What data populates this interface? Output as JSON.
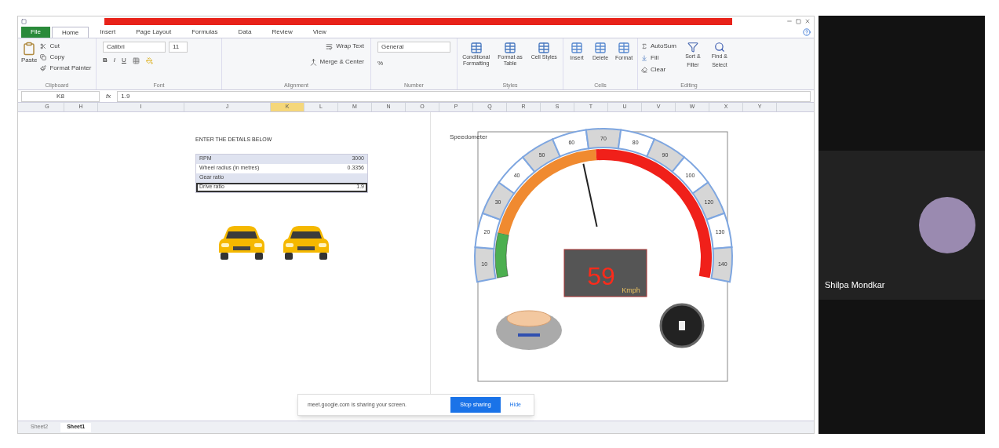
{
  "excel": {
    "ribbon_tabs": [
      {
        "label": "File",
        "kind": "file",
        "selected": false
      },
      {
        "label": "Home",
        "kind": "tab",
        "selected": true
      },
      {
        "label": "Insert",
        "kind": "tab",
        "selected": false
      },
      {
        "label": "Page Layout",
        "kind": "tab",
        "selected": false
      },
      {
        "label": "Formulas",
        "kind": "tab",
        "selected": false
      },
      {
        "label": "Data",
        "kind": "tab",
        "selected": false
      },
      {
        "label": "Review",
        "kind": "tab",
        "selected": false
      },
      {
        "label": "View",
        "kind": "tab",
        "selected": false
      }
    ],
    "clipboard": {
      "paste": "Paste",
      "cut": "Cut",
      "copy": "Copy",
      "format_painter": "Format Painter",
      "group": "Clipboard"
    },
    "font": {
      "name": "Calibri",
      "size": "11",
      "bold": "B",
      "italic": "I",
      "underline": "U",
      "group": "Font"
    },
    "alignment": {
      "wrap": "Wrap Text",
      "merge": "Merge & Center",
      "group": "Alignment"
    },
    "number": {
      "format": "General",
      "percent": "%",
      "group": "Number"
    },
    "styles": {
      "buttons": [
        "Conditional Formatting",
        "Format as Table",
        "Cell Styles"
      ],
      "group": "Styles"
    },
    "cells": {
      "buttons": [
        "Insert",
        "Delete",
        "Format"
      ],
      "group": "Cells"
    },
    "editing": {
      "autosum": "AutoSum",
      "fill": "Fill",
      "clear": "Clear",
      "sort": "Sort & Filter",
      "find": "Find & Select",
      "group": "Editing"
    },
    "formula_bar": {
      "name_box": "K8",
      "fx": "fx",
      "value": "1.9"
    },
    "columns": [
      {
        "label": "G",
        "selected": false
      },
      {
        "label": "H",
        "selected": false
      },
      {
        "label": "I",
        "selected": false
      },
      {
        "label": "J",
        "selected": false
      },
      {
        "label": "K",
        "selected": true
      },
      {
        "label": "L",
        "selected": false
      },
      {
        "label": "M",
        "selected": false
      },
      {
        "label": "N",
        "selected": false
      },
      {
        "label": "O",
        "selected": false
      },
      {
        "label": "P",
        "selected": false
      },
      {
        "label": "Q",
        "selected": false
      },
      {
        "label": "R",
        "selected": false
      },
      {
        "label": "S",
        "selected": false
      },
      {
        "label": "T",
        "selected": false
      },
      {
        "label": "U",
        "selected": false
      },
      {
        "label": "V",
        "selected": false
      },
      {
        "label": "W",
        "selected": false
      },
      {
        "label": "X",
        "selected": false
      },
      {
        "label": "Y",
        "selected": false
      }
    ],
    "details": {
      "heading": "ENTER THE DETAILS BELOW",
      "rows": [
        {
          "label": "RPM",
          "value": "3000",
          "selected": false
        },
        {
          "label": "Wheel radius (in metres)",
          "value": "0.3356",
          "selected": false
        },
        {
          "label": "Gear ratio",
          "selected": false
        },
        {
          "label": "Drive ratio",
          "value": "1.9",
          "selected": true
        }
      ]
    },
    "speedometer": {
      "title": "Speedometer",
      "ticks": [
        "10",
        "20",
        "30",
        "40",
        "50",
        "60",
        "70",
        "80",
        "90",
        "100",
        "120",
        "130",
        "140"
      ],
      "needle": {
        "level": 0.44
      },
      "reading": "59",
      "unit": "Kmph"
    },
    "sheet_tabs": [
      {
        "label": "Sheet2",
        "selected": false
      },
      {
        "label": "Sheet1",
        "selected": true
      }
    ]
  },
  "share_banner": {
    "message": "meet.google.com is sharing your screen.",
    "stop": "Stop sharing",
    "hide": "Hide"
  },
  "participant": {
    "name": "Shilpa Mondkar"
  }
}
